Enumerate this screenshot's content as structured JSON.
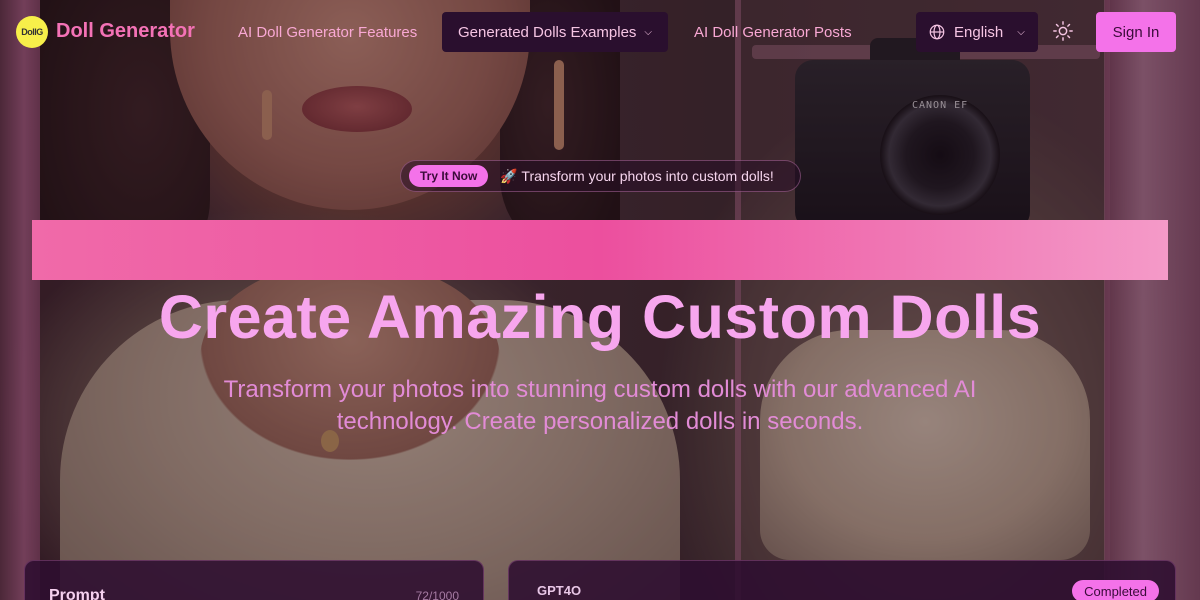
{
  "brand": {
    "logo_text": "DollG",
    "name": "Doll Generator"
  },
  "nav": {
    "links": [
      {
        "label": "AI Doll Generator Features"
      },
      {
        "label": "Generated Dolls Examples",
        "has_dropdown": true
      },
      {
        "label": "AI Doll Generator Posts"
      }
    ],
    "language": "English",
    "sign_in": "Sign In"
  },
  "hero": {
    "badge": "Try It Now",
    "tagline": "🚀 Transform your photos into custom dolls!",
    "headline": "Create Amazing Custom Dolls",
    "subheadline": "Transform your photos into stunning custom dolls with our advanced AI technology. Create personalized dolls in seconds."
  },
  "prompt_card": {
    "title": "Prompt",
    "char_count": "72/1000"
  },
  "result_card": {
    "model": "GPT4O",
    "status": "Completed"
  },
  "background": {
    "camera_text": "CANON EF"
  },
  "colors": {
    "accent": "#f472e9",
    "brand": "#f472b6",
    "banner": "#ec4f9e"
  },
  "icons": [
    "globe-icon",
    "chevron-down-icon",
    "sun-icon"
  ]
}
